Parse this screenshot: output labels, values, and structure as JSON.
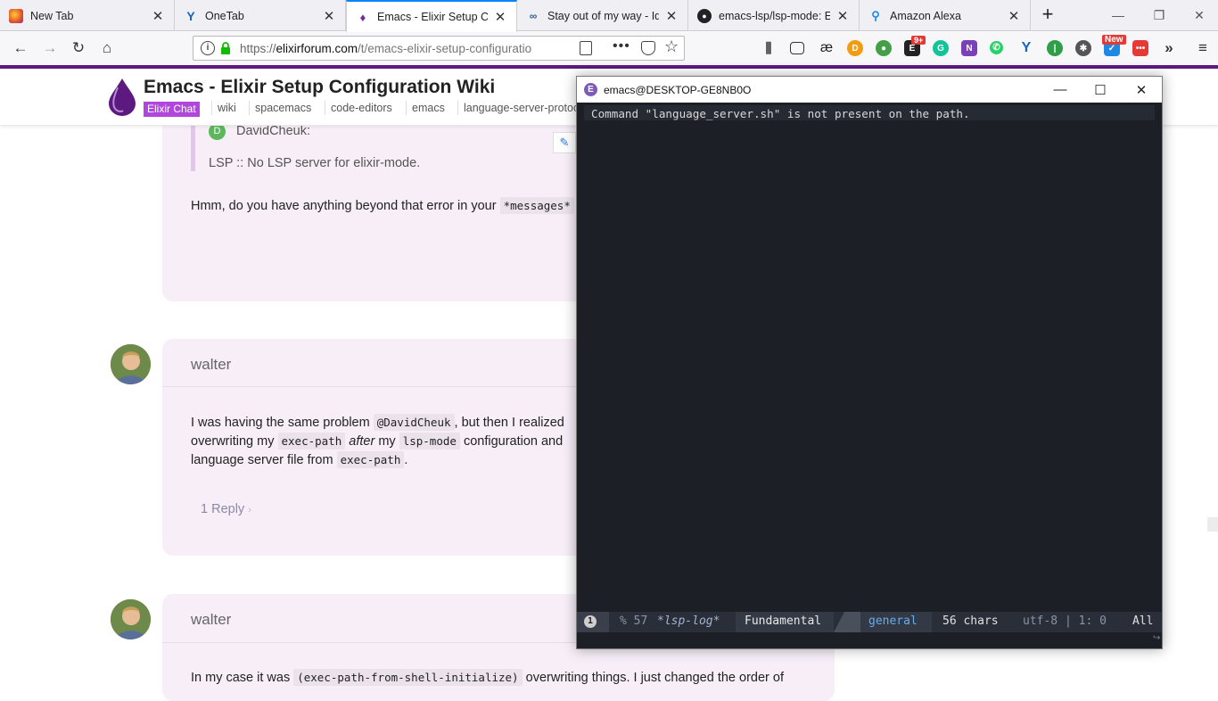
{
  "tabs": [
    {
      "title": "New Tab",
      "icon": "firefox-icon"
    },
    {
      "title": "OneTab",
      "icon": "onetab-icon"
    },
    {
      "title": "Emacs - Elixir Setup Conf",
      "icon": "elixir-icon",
      "active": true
    },
    {
      "title": "Stay out of my way - Idio",
      "icon": "idio-icon"
    },
    {
      "title": "emacs-lsp/lsp-mode: Em",
      "icon": "github-icon"
    },
    {
      "title": "Amazon Alexa",
      "icon": "alexa-icon"
    }
  ],
  "urlbar": {
    "prefix": "https://",
    "domain": "elixirforum.com",
    "path": "/t/emacs-elixir-setup-configuratio"
  },
  "extensions": {
    "badge_count": "9+",
    "badge_new": "New",
    "ae_label": "æ"
  },
  "forum": {
    "topic_title": "Emacs - Elixir Setup Configuration Wiki",
    "category": "Elixir Chat",
    "tags": [
      "wiki",
      "spacemacs",
      "code-editors",
      "emacs",
      "language-server-protoc"
    ]
  },
  "quote": {
    "author": "DavidCheuk:",
    "author_initial": "D",
    "text": "LSP :: No LSP server for elixir-mode."
  },
  "post1": {
    "text_before": "Hmm, do you have anything beyond that error in your",
    "code": "*messages*"
  },
  "post2": {
    "username": "walter",
    "line1_a": "I was having the same problem",
    "line1_mention": "@DavidCheuk",
    "line1_b": ", but then I realized",
    "line2_a": "overwriting my",
    "line2_code1": "exec-path",
    "line2_em": "after",
    "line2_b": "my",
    "line2_code2": "lsp-mode",
    "line2_c": "configuration and",
    "line3_a": "language server file from",
    "line3_code": "exec-path",
    "line3_b": ".",
    "reply_link": "1 Reply"
  },
  "post3": {
    "username": "walter",
    "line1_a": "In my case it was",
    "line1_code": "(exec-path-from-shell-initialize)",
    "line1_b": "overwriting things. I just changed the order of"
  },
  "emacs": {
    "window_title": "emacs@DESKTOP-GE8NB0O",
    "buffer_text": "Command \"language_server.sh\" is not present on the path.",
    "modeline": {
      "window_number": "1",
      "percent_size": "% 57",
      "buffer_name": "*lsp-log*",
      "major_mode": "Fundamental",
      "workspace": "general",
      "char_count": "56 chars",
      "encoding": "utf-8 | 1: 0",
      "position": "All"
    }
  },
  "colors": {
    "accent_purple": "#5c1a80",
    "category_badge": "#b146dc",
    "emacs_bg": "#1c1f26",
    "tab_active_line": "#0a84ff"
  }
}
